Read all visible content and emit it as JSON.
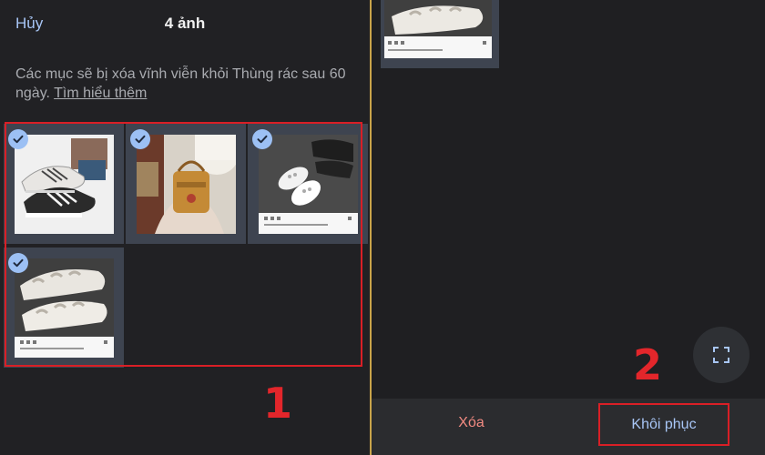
{
  "header": {
    "cancel_label": "Hủy",
    "title": "4 ảnh"
  },
  "info": {
    "text": "Các mục sẽ bị xóa vĩnh viễn khỏi Thùng rác sau 60 ngày.",
    "learn_more": "Tìm hiểu thêm"
  },
  "photos": [
    {
      "id": "sneakers-black-white",
      "selected": true
    },
    {
      "id": "bag-charm",
      "selected": true
    },
    {
      "id": "white-clogs-post",
      "selected": true
    },
    {
      "id": "foam-runners-post",
      "selected": true
    }
  ],
  "actions": {
    "delete_label": "Xóa",
    "restore_label": "Khôi phục"
  },
  "annotations": {
    "marker_1": "1",
    "marker_2": "2"
  },
  "colors": {
    "accent_blue": "#a8c6f6",
    "delete_red": "#f28b82",
    "highlight_red": "#d91f26"
  },
  "icons": {
    "check": "checkmark-icon",
    "fullscreen": "fullscreen-icon"
  }
}
